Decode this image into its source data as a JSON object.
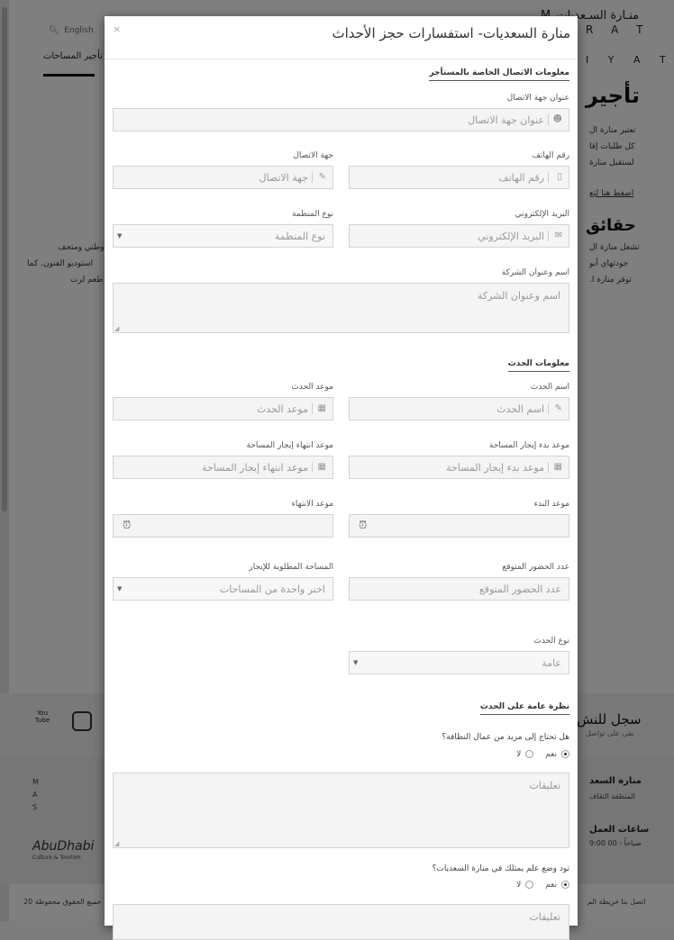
{
  "background": {
    "brand_line1": "منـارة السـعديات M",
    "brand_line2": "R A T",
    "brand_line3": "I Y A T",
    "lang": "English",
    "nav_rent": "تأجير المساحات",
    "heading1": "تأجير",
    "para1": [
      "تعتبر منارة ال",
      "كل طلبات إقا",
      "لستقبل منارة"
    ],
    "link1": "اضغط هنا لتع",
    "heading2": "حقائق",
    "para2_right": [
      "تشغل منارة ال",
      "جودتهاي أبو",
      "توفر منارة ا."
    ],
    "para2_left": [
      "وطني ومتحف",
      "استوديو الفنون. كما",
      "طعم لرت"
    ],
    "signup": "سجل للنش",
    "signup_sub": "بقى على تواصل",
    "youtube": "You Tube",
    "footer_name": "منارة السعد",
    "footer_area": "المنطقة الثقاف",
    "footer_hours": "ساعات العمل",
    "footer_hours_val": "9:00 صباحاً - 00",
    "footer_links": "اتصل بنا   خريطة الم",
    "footer_rights": "20 جميع الحقوق محفوظة",
    "partner": "AbuDhabi",
    "partner_sub": "Culture & Tourism"
  },
  "modal": {
    "close_label": "×",
    "title": "منارة السعديات- استفسارات حجز الأحداث",
    "section_contact": "معلومات الاتصال الخاصة بالمستأجر",
    "section_event": "معلومات الحدث",
    "section_overview": "نظرة عامة على الحدث",
    "fields": {
      "contact_address": {
        "label": "عنوان جهة الاتصال",
        "placeholder": "عنوان جهة الاتصال",
        "icon": "user-icon"
      },
      "phone": {
        "label": "رقم الهاتف",
        "placeholder": "رقم الهاتف",
        "icon": "mobile-icon"
      },
      "contact": {
        "label": "جهة الاتصال",
        "placeholder": "جهة الاتصال",
        "icon": "edit-icon"
      },
      "email": {
        "label": "البريد الإلكتروني",
        "placeholder": "البريد الإلكتروني",
        "icon": "envelope-icon"
      },
      "org_type": {
        "label": "نوع المنظمة",
        "value": "نوع المنظمة"
      },
      "company": {
        "label": "اسم وعنوان الشركة",
        "placeholder": "اسم وعنوان الشركة"
      },
      "event_name": {
        "label": "اسم الحدث",
        "placeholder": "اسم الحدث",
        "icon": "edit-icon"
      },
      "event_date": {
        "label": "موعد الحدث",
        "placeholder": "موعد الحدث",
        "icon": "calendar-icon"
      },
      "rent_start": {
        "label": "موعد بدء إيجار المساحة",
        "placeholder": "موعد بدء إيجار المساحة",
        "icon": "calendar-icon"
      },
      "rent_end": {
        "label": "موعد انتهاء إيجار المساحة",
        "placeholder": "موعد انتهاء إيجار المساحة",
        "icon": "calendar-icon"
      },
      "start_time": {
        "label": "موعد البدء",
        "icon": "clock-icon"
      },
      "end_time": {
        "label": "موعد الانتهاء",
        "icon": "clock-icon"
      },
      "attendance": {
        "label": "عدد الحضور المتوقع",
        "placeholder": "عدد الحضور المتوقع"
      },
      "space": {
        "label": "المساحة المطلوبة للإيجار",
        "value": "اختر واحدة من المساحات"
      },
      "event_type": {
        "label": "نوع الحدث",
        "value": "عامة"
      }
    },
    "q_cleaning": "هل تحتاج إلى مزيد من عمال النظافة؟",
    "q_flag": "تود وضع علم يمثلك في منارة السعديات؟",
    "yes": "نعم",
    "no": "لا",
    "comments_placeholder": "تعليقات"
  }
}
